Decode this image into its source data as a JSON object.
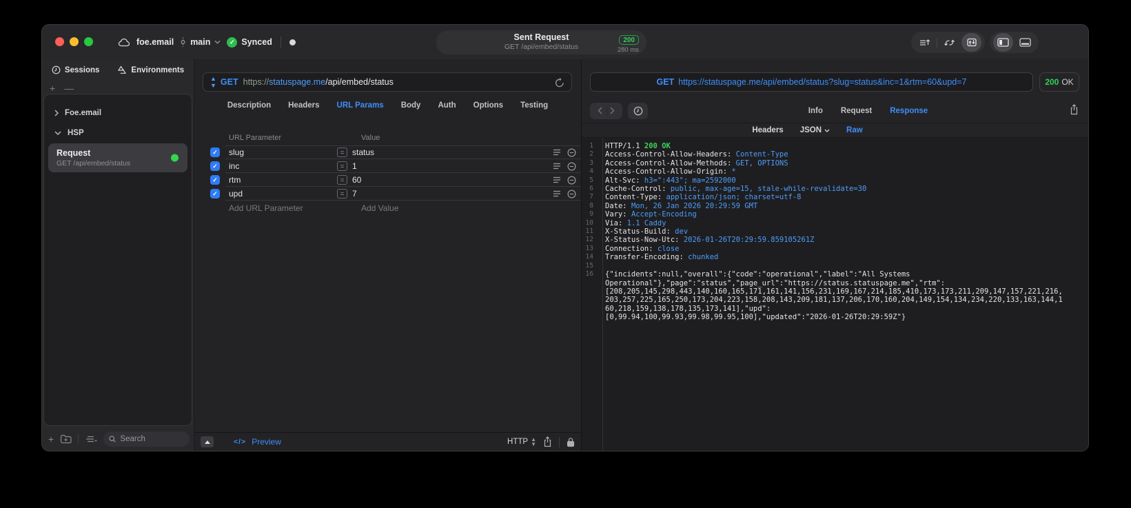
{
  "titlebar": {
    "project": "foe.email",
    "branch": "main",
    "synced_label": "Synced",
    "request_title": "Sent Request",
    "request_subtitle": "GET /api/embed/status",
    "status_code": "200",
    "duration": "280 ms"
  },
  "sidebar": {
    "tabs": [
      {
        "label": "Sessions"
      },
      {
        "label": "Environments"
      }
    ],
    "glyphs": {
      "add": "+",
      "remove": "—"
    },
    "tree": [
      {
        "label": "Foe.email",
        "state": "collapsed"
      },
      {
        "label": "HSP",
        "state": "expanded"
      }
    ],
    "request_item": {
      "title": "Request",
      "subtitle": "GET /api/embed/status"
    },
    "search_placeholder": "Search"
  },
  "request_panel": {
    "method": "GET",
    "url": {
      "scheme": "https://",
      "host": "statuspage.me",
      "path": "/api/embed/status"
    },
    "tabs": [
      "Description",
      "Headers",
      "URL Params",
      "Body",
      "Auth",
      "Options",
      "Testing"
    ],
    "active_tab": "URL Params",
    "params": {
      "col_param": "URL Parameter",
      "col_value": "Value",
      "rows": [
        {
          "name": "slug",
          "value": "status",
          "enabled": true
        },
        {
          "name": "inc",
          "value": "1",
          "enabled": true
        },
        {
          "name": "rtm",
          "value": "60",
          "enabled": true
        },
        {
          "name": "upd",
          "value": "7",
          "enabled": true
        }
      ],
      "add_param": "Add URL Parameter",
      "add_value": "Add Value"
    },
    "footer": {
      "code_glyph": "</>",
      "preview": "Preview",
      "protocol": "HTTP"
    }
  },
  "response_panel": {
    "method": "GET",
    "url": "https://statuspage.me/api/embed/status?slug=status&inc=1&rtm=60&upd=7",
    "status": {
      "code": "200",
      "text": "OK"
    },
    "tabs": [
      "Info",
      "Request",
      "Response"
    ],
    "active_tab": "Response",
    "subtabs": [
      "Headers",
      "JSON",
      "Raw"
    ],
    "active_subtab": "Raw",
    "body_lines": [
      {
        "n": "1",
        "parts": [
          [
            "HTTP/1.1 ",
            "w"
          ],
          [
            "200 OK",
            "g"
          ]
        ]
      },
      {
        "n": "2",
        "parts": [
          [
            "Access-Control-Allow-Headers",
            "w"
          ],
          [
            ": ",
            "w"
          ],
          [
            "Content-Type",
            "b"
          ]
        ]
      },
      {
        "n": "3",
        "parts": [
          [
            "Access-Control-Allow-Methods",
            "w"
          ],
          [
            ": ",
            "w"
          ],
          [
            "GET, OPTIONS",
            "b"
          ]
        ]
      },
      {
        "n": "4",
        "parts": [
          [
            "Access-Control-Allow-Origin",
            "w"
          ],
          [
            ": ",
            "w"
          ],
          [
            "*",
            "b"
          ]
        ]
      },
      {
        "n": "5",
        "parts": [
          [
            "Alt-Svc",
            "w"
          ],
          [
            ": ",
            "w"
          ],
          [
            "h3=\":443\"; ma=2592000",
            "b"
          ]
        ]
      },
      {
        "n": "6",
        "parts": [
          [
            "Cache-Control",
            "w"
          ],
          [
            ": ",
            "w"
          ],
          [
            "public, max-age=15, stale-while-revalidate=30",
            "b"
          ]
        ]
      },
      {
        "n": "7",
        "parts": [
          [
            "Content-Type",
            "w"
          ],
          [
            ": ",
            "w"
          ],
          [
            "application/json; charset=utf-8",
            "b"
          ]
        ]
      },
      {
        "n": "8",
        "parts": [
          [
            "Date",
            "w"
          ],
          [
            ": ",
            "w"
          ],
          [
            "Mon, 26 Jan 2026 20:29:59 GMT",
            "b"
          ]
        ]
      },
      {
        "n": "9",
        "parts": [
          [
            "Vary",
            "w"
          ],
          [
            ": ",
            "w"
          ],
          [
            "Accept-Encoding",
            "b"
          ]
        ]
      },
      {
        "n": "10",
        "parts": [
          [
            "Via",
            "w"
          ],
          [
            ": ",
            "w"
          ],
          [
            "1.1 Caddy",
            "b"
          ]
        ]
      },
      {
        "n": "11",
        "parts": [
          [
            "X-Status-Build",
            "w"
          ],
          [
            ": ",
            "w"
          ],
          [
            "dev",
            "b"
          ]
        ]
      },
      {
        "n": "12",
        "parts": [
          [
            "X-Status-Now-Utc",
            "w"
          ],
          [
            ": ",
            "w"
          ],
          [
            "2026-01-26T20:29:59.859105261Z",
            "b"
          ]
        ]
      },
      {
        "n": "13",
        "parts": [
          [
            "Connection",
            "w"
          ],
          [
            ": ",
            "w"
          ],
          [
            "close",
            "b"
          ]
        ]
      },
      {
        "n": "14",
        "parts": [
          [
            "Transfer-Encoding",
            "w"
          ],
          [
            ": ",
            "w"
          ],
          [
            "chunked",
            "b"
          ]
        ]
      },
      {
        "n": "15",
        "parts": []
      },
      {
        "n": "16",
        "parts": [],
        "wrap": [
          "{\"incidents\":null,\"overall\":{\"code\":\"operational\",\"label\":\"All Systems",
          "Operational\"},\"page\":\"status\",\"page_url\":\"https://status.statuspage.me\",\"rtm\":",
          "[208,205,145,298,443,140,160,165,171,161,141,156,231,169,167,214,185,410,173,173,211,209,147,157,221,216,",
          "203,257,225,165,250,173,204,223,158,208,143,209,181,137,206,170,160,204,149,154,134,234,220,133,163,144,1",
          "60,218,159,138,178,135,173,141],\"upd\":",
          "[0,99.94,100,99.93,99.98,99.95,100],\"updated\":\"2026-01-26T20:29:59Z\"}"
        ]
      }
    ]
  }
}
